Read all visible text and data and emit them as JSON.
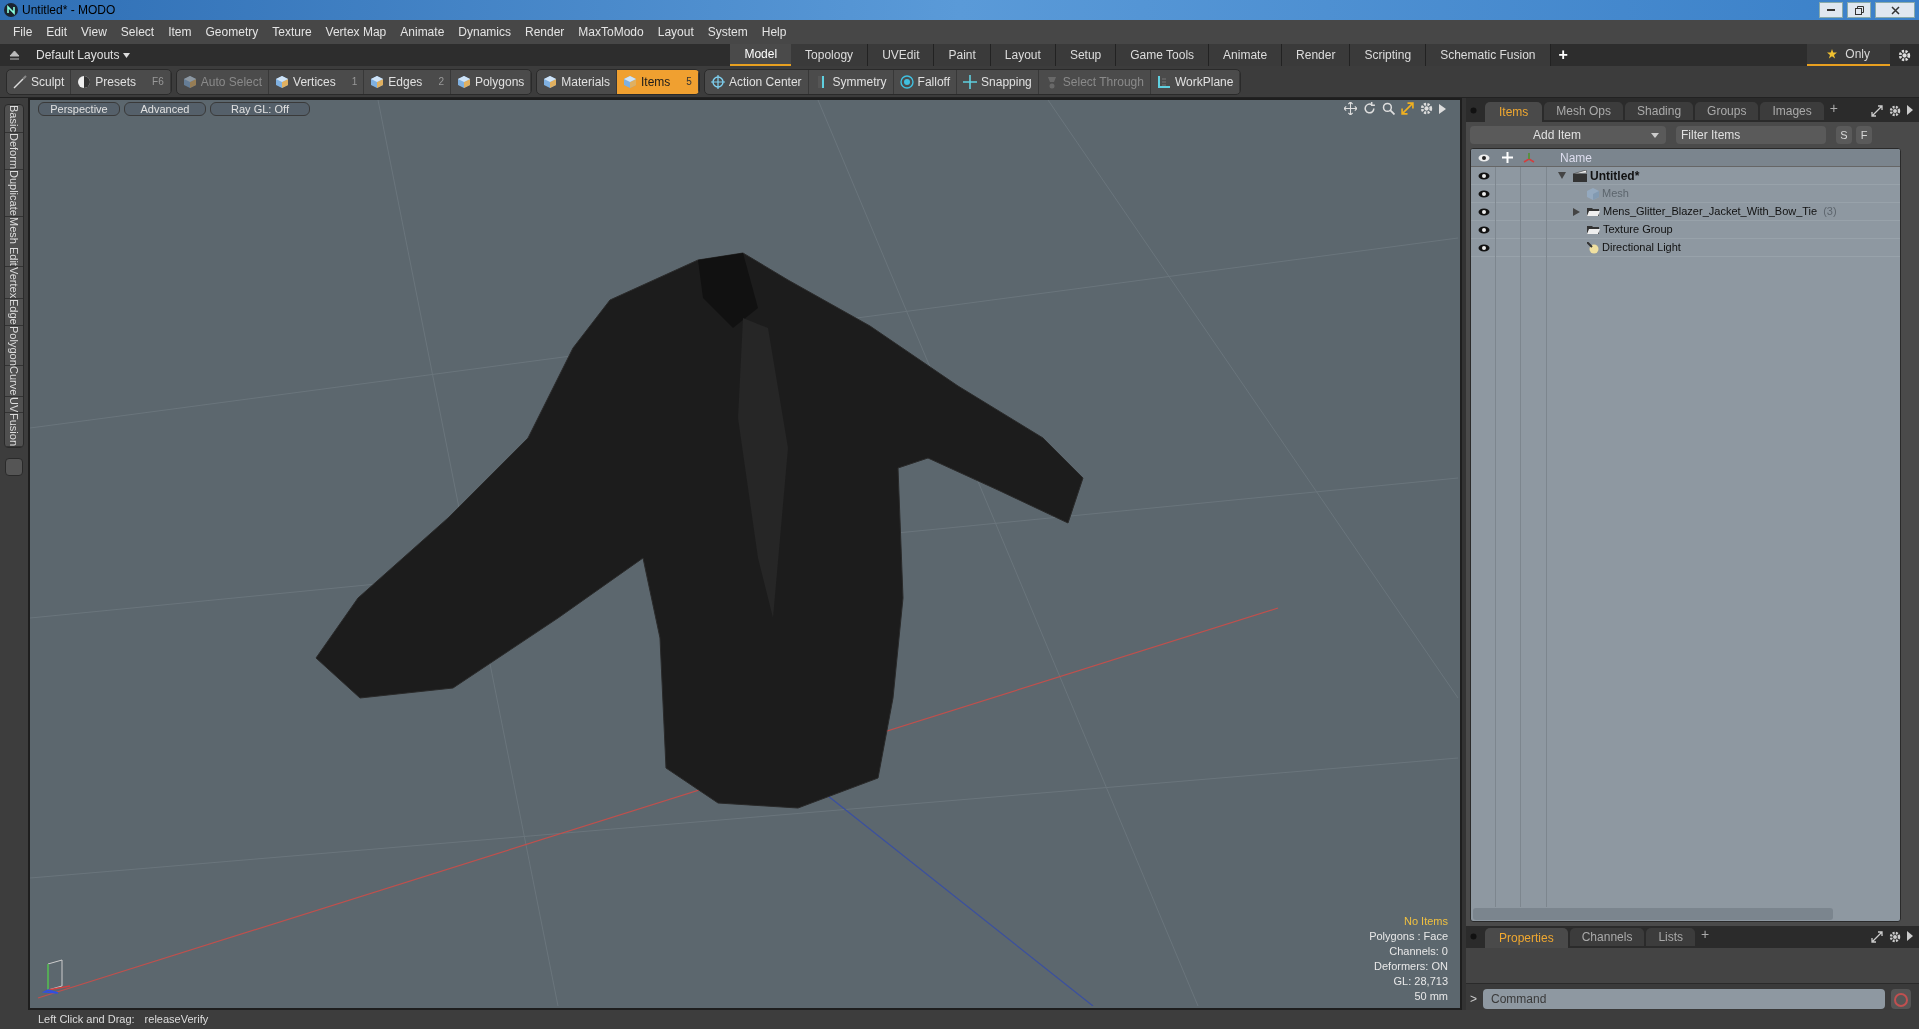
{
  "window": {
    "title": "Untitled* - MODO"
  },
  "menu": [
    "File",
    "Edit",
    "View",
    "Select",
    "Item",
    "Geometry",
    "Texture",
    "Vertex Map",
    "Animate",
    "Dynamics",
    "Render",
    "MaxToModo",
    "Layout",
    "System",
    "Help"
  ],
  "layout_bar": {
    "layouts": "Default Layouts",
    "tabs": [
      {
        "label": "Model",
        "selected": true
      },
      {
        "label": "Topology",
        "selected": false
      },
      {
        "label": "UVEdit",
        "selected": false
      },
      {
        "label": "Paint",
        "selected": false
      },
      {
        "label": "Layout",
        "selected": false
      },
      {
        "label": "Setup",
        "selected": false
      },
      {
        "label": "Game Tools",
        "selected": false
      },
      {
        "label": "Animate",
        "selected": false
      },
      {
        "label": "Render",
        "selected": false
      },
      {
        "label": "Scripting",
        "selected": false
      },
      {
        "label": "Schematic Fusion",
        "selected": false
      }
    ],
    "add": "+",
    "only": "Only"
  },
  "toolbar_groups": [
    {
      "items": [
        {
          "label": "Sculpt",
          "kind": "sculpt",
          "selected": false,
          "disabled": false
        },
        {
          "label": "Presets",
          "kind": "presets",
          "shortcut": "F6",
          "selected": false,
          "disabled": false
        }
      ]
    },
    {
      "items": [
        {
          "label": "Auto Select",
          "kind": "mode",
          "selected": false,
          "disabled": true
        },
        {
          "label": "Vertices",
          "kind": "mode",
          "shortcut": "1",
          "selected": false,
          "disabled": false
        },
        {
          "label": "Edges",
          "kind": "mode",
          "shortcut": "2",
          "selected": false,
          "disabled": false
        },
        {
          "label": "Polygons",
          "kind": "mode",
          "selected": false,
          "disabled": false
        }
      ]
    },
    {
      "items": [
        {
          "label": "Materials",
          "kind": "mode",
          "selected": false,
          "disabled": false
        },
        {
          "label": "Items",
          "kind": "mode",
          "shortcut": "5",
          "selected": true,
          "disabled": false
        }
      ]
    },
    {
      "items": [
        {
          "label": "Action Center",
          "kind": "center",
          "selected": false,
          "disabled": false
        },
        {
          "label": "Symmetry",
          "kind": "symmetry",
          "selected": false,
          "disabled": false
        },
        {
          "label": "Falloff",
          "kind": "falloff",
          "selected": false,
          "disabled": false
        },
        {
          "label": "Snapping",
          "kind": "snap",
          "selected": false,
          "disabled": false
        },
        {
          "label": "Select Through",
          "kind": "through",
          "selected": false,
          "disabled": true
        },
        {
          "label": "WorkPlane",
          "kind": "workplane",
          "selected": false,
          "disabled": false
        }
      ]
    }
  ],
  "side_tabs": [
    "Basic",
    "Deform",
    "Duplicate",
    "Mesh Edit",
    "Vertex",
    "Edge",
    "Polygon",
    "Curve",
    "UV",
    "Fusion"
  ],
  "viewport": {
    "buttons": [
      "Perspective",
      "Advanced",
      "Ray GL: Off"
    ],
    "stats": [
      {
        "text": "No Items",
        "highlight": true
      },
      {
        "text": "Polygons : Face",
        "highlight": false
      },
      {
        "text": "Channels: 0",
        "highlight": false
      },
      {
        "text": "Deformers: ON",
        "highlight": false
      },
      {
        "text": "GL: 28,713",
        "highlight": false
      },
      {
        "text": "50 mm",
        "highlight": false
      }
    ]
  },
  "items_panel": {
    "tabs": [
      {
        "label": "Items",
        "selected": true
      },
      {
        "label": "Mesh Ops",
        "selected": false
      },
      {
        "label": "Shading",
        "selected": false
      },
      {
        "label": "Groups",
        "selected": false
      },
      {
        "label": "Images",
        "selected": false
      }
    ],
    "add_tab": "+",
    "add_item": "Add Item",
    "filter_placeholder": "Filter Items",
    "s_button": "S",
    "f_button": "F",
    "name_header": "Name",
    "tree": [
      {
        "label": "Untitled*",
        "kind": "scene",
        "expanded": true,
        "disabled": false,
        "children": [
          {
            "label": "Mesh",
            "kind": "mesh",
            "disabled": true
          },
          {
            "label": "Mens_Glitter_Blazer_Jacket_With_Bow_Tie",
            "count": "(3)",
            "kind": "group",
            "expanded": false,
            "disabled": false
          },
          {
            "label": "Texture Group",
            "kind": "group",
            "disabled": false
          },
          {
            "label": "Directional Light",
            "kind": "light",
            "disabled": false
          }
        ]
      }
    ]
  },
  "properties_panel": {
    "tabs": [
      {
        "label": "Properties",
        "selected": true
      },
      {
        "label": "Channels",
        "selected": false
      },
      {
        "label": "Lists",
        "selected": false
      }
    ],
    "add_tab": "+"
  },
  "command": {
    "prompt": ">",
    "placeholder": "Command"
  },
  "status_bar": {
    "label": "Left Click and Drag:",
    "value": "releaseVerify"
  }
}
